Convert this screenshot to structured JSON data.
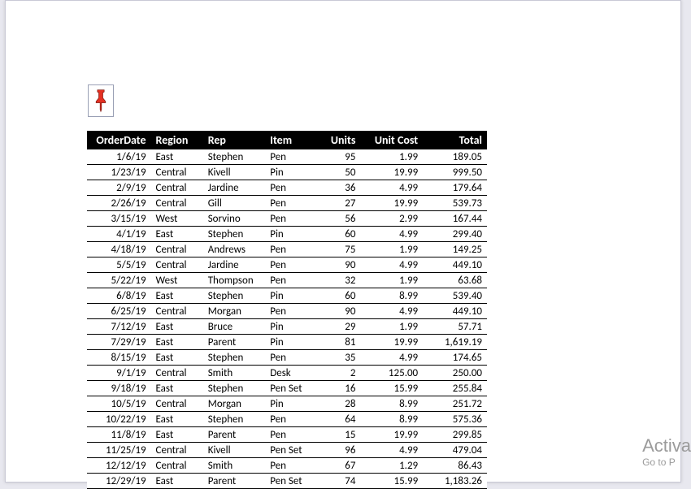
{
  "watermark": {
    "line1": "Activa",
    "line2": "Go to P"
  },
  "chart_data": {
    "type": "table",
    "title": "",
    "headers": [
      "OrderDate",
      "Region",
      "Rep",
      "Item",
      "Units",
      "Unit Cost",
      "Total"
    ],
    "rows": [
      {
        "OrderDate": "1/6/19",
        "Region": "East",
        "Rep": "Stephen",
        "Item": "Pen",
        "Units": 95,
        "UnitCost": 1.99,
        "Total": 189.05
      },
      {
        "OrderDate": "1/23/19",
        "Region": "Central",
        "Rep": "Kivell",
        "Item": "Pin",
        "Units": 50,
        "UnitCost": 19.99,
        "Total": 999.5
      },
      {
        "OrderDate": "2/9/19",
        "Region": "Central",
        "Rep": "Jardine",
        "Item": "Pen",
        "Units": 36,
        "UnitCost": 4.99,
        "Total": 179.64
      },
      {
        "OrderDate": "2/26/19",
        "Region": "Central",
        "Rep": "Gill",
        "Item": "Pen",
        "Units": 27,
        "UnitCost": 19.99,
        "Total": 539.73
      },
      {
        "OrderDate": "3/15/19",
        "Region": "West",
        "Rep": "Sorvino",
        "Item": "Pen",
        "Units": 56,
        "UnitCost": 2.99,
        "Total": 167.44
      },
      {
        "OrderDate": "4/1/19",
        "Region": "East",
        "Rep": "Stephen",
        "Item": "Pin",
        "Units": 60,
        "UnitCost": 4.99,
        "Total": 299.4
      },
      {
        "OrderDate": "4/18/19",
        "Region": "Central",
        "Rep": "Andrews",
        "Item": "Pen",
        "Units": 75,
        "UnitCost": 1.99,
        "Total": 149.25
      },
      {
        "OrderDate": "5/5/19",
        "Region": "Central",
        "Rep": "Jardine",
        "Item": "Pen",
        "Units": 90,
        "UnitCost": 4.99,
        "Total": 449.1
      },
      {
        "OrderDate": "5/22/19",
        "Region": "West",
        "Rep": "Thompson",
        "Item": "Pen",
        "Units": 32,
        "UnitCost": 1.99,
        "Total": 63.68
      },
      {
        "OrderDate": "6/8/19",
        "Region": "East",
        "Rep": "Stephen",
        "Item": "Pin",
        "Units": 60,
        "UnitCost": 8.99,
        "Total": 539.4
      },
      {
        "OrderDate": "6/25/19",
        "Region": "Central",
        "Rep": "Morgan",
        "Item": "Pen",
        "Units": 90,
        "UnitCost": 4.99,
        "Total": 449.1
      },
      {
        "OrderDate": "7/12/19",
        "Region": "East",
        "Rep": "Bruce",
        "Item": "Pin",
        "Units": 29,
        "UnitCost": 1.99,
        "Total": 57.71
      },
      {
        "OrderDate": "7/29/19",
        "Region": "East",
        "Rep": "Parent",
        "Item": "Pin",
        "Units": 81,
        "UnitCost": 19.99,
        "Total": 1619.19
      },
      {
        "OrderDate": "8/15/19",
        "Region": "East",
        "Rep": "Stephen",
        "Item": "Pen",
        "Units": 35,
        "UnitCost": 4.99,
        "Total": 174.65
      },
      {
        "OrderDate": "9/1/19",
        "Region": "Central",
        "Rep": "Smith",
        "Item": "Desk",
        "Units": 2,
        "UnitCost": 125.0,
        "Total": 250.0
      },
      {
        "OrderDate": "9/18/19",
        "Region": "East",
        "Rep": "Stephen",
        "Item": "Pen Set",
        "Units": 16,
        "UnitCost": 15.99,
        "Total": 255.84
      },
      {
        "OrderDate": "10/5/19",
        "Region": "Central",
        "Rep": "Morgan",
        "Item": "Pin",
        "Units": 28,
        "UnitCost": 8.99,
        "Total": 251.72
      },
      {
        "OrderDate": "10/22/19",
        "Region": "East",
        "Rep": "Stephen",
        "Item": "Pen",
        "Units": 64,
        "UnitCost": 8.99,
        "Total": 575.36
      },
      {
        "OrderDate": "11/8/19",
        "Region": "East",
        "Rep": "Parent",
        "Item": "Pen",
        "Units": 15,
        "UnitCost": 19.99,
        "Total": 299.85
      },
      {
        "OrderDate": "11/25/19",
        "Region": "Central",
        "Rep": "Kivell",
        "Item": "Pen Set",
        "Units": 96,
        "UnitCost": 4.99,
        "Total": 479.04
      },
      {
        "OrderDate": "12/12/19",
        "Region": "Central",
        "Rep": "Smith",
        "Item": "Pen",
        "Units": 67,
        "UnitCost": 1.29,
        "Total": 86.43
      },
      {
        "OrderDate": "12/29/19",
        "Region": "East",
        "Rep": "Parent",
        "Item": "Pen Set",
        "Units": 74,
        "UnitCost": 15.99,
        "Total": 1183.26
      }
    ]
  }
}
